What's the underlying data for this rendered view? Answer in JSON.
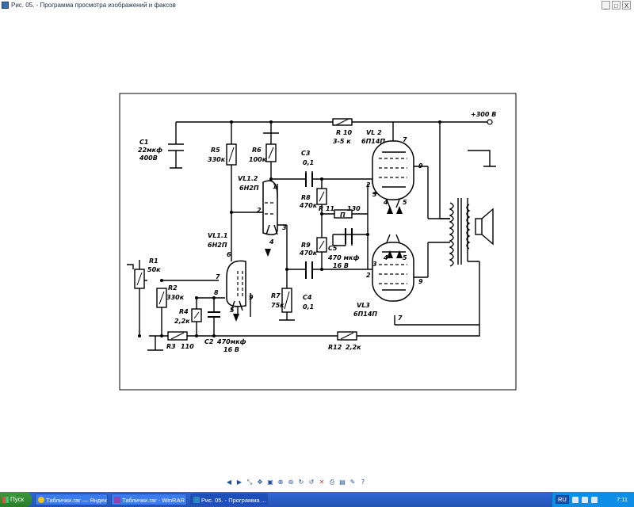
{
  "window": {
    "title": "Рис. 05. - Программа просмотра изображений и факсов",
    "buttons": [
      "_",
      "□",
      "X"
    ]
  },
  "schematic": {
    "supply": "+300 В",
    "parts": {
      "c1": [
        "C1",
        "22мкф",
        "400В"
      ],
      "r5": [
        "R5",
        "330к"
      ],
      "r6": [
        "R6",
        "100к"
      ],
      "c3": [
        "C3",
        "0,1"
      ],
      "r10": [
        "R 10",
        "3-5 к"
      ],
      "vl2": [
        "VL 2",
        "6П14П"
      ],
      "vl12": [
        "VL1.2",
        "6Н2П"
      ],
      "r8": [
        "R8",
        "470к"
      ],
      "r11": [
        "R 11",
        "130"
      ],
      "r11body": "П",
      "c5": [
        "C5",
        "470 мкф",
        "16 В"
      ],
      "r9": [
        "R9",
        "470к"
      ],
      "vl11": [
        "VL1.1",
        "6Н2П"
      ],
      "r1": [
        "R1",
        "50к"
      ],
      "r2": [
        "R2",
        "330к"
      ],
      "r4": [
        "R4",
        "2,2к"
      ],
      "r7": [
        "R7",
        "75к"
      ],
      "c4": [
        "C4",
        "0,1"
      ],
      "vl3": [
        "VL3",
        "6П14П"
      ],
      "r3": [
        "R3",
        "110"
      ],
      "c2": [
        "C2",
        "470мкф",
        "16 В"
      ],
      "r12": [
        "R12",
        "2,2к"
      ]
    },
    "pins": {
      "vl2_7": "7",
      "vl2_9": "9",
      "vl2_2": "2",
      "vl2_3": "3",
      "vl2_4": "4",
      "vl2_5": "5",
      "vl3_4": "4",
      "vl3_5": "5",
      "vl3_3": "3",
      "vl3_2": "2",
      "vl3_9": "9",
      "vl3_7": "7",
      "vl12_1": "1",
      "vl12_2": "2",
      "vl12_3": "3",
      "vl12_4": "4",
      "vl11_6": "6",
      "vl11_7": "7",
      "vl11_8": "8",
      "vl11_5": "5",
      "vl11_9": "9"
    }
  },
  "viewer_toolbar": [
    "prev-icon",
    "next-icon",
    "best-fit-icon",
    "actual-size-icon",
    "slideshow-icon",
    "zoom-in-icon",
    "zoom-out-icon",
    "rotate-cw-icon",
    "rotate-ccw-icon",
    "delete-icon",
    "print-icon",
    "save-icon",
    "edit-icon",
    "help-icon"
  ],
  "taskbar": {
    "start": "Пуск",
    "tasks": [
      "Таблички.rar — Яндекс....",
      "Таблички.rar - WinRAR ...",
      "Рис. 05. - Программа ..."
    ],
    "lang": "RU",
    "clock": "7:11"
  },
  "colors": {
    "taskbar": "#2453b5",
    "start": "#3c9a3c",
    "tray": "#0f8ee8",
    "ink": "#000000"
  }
}
